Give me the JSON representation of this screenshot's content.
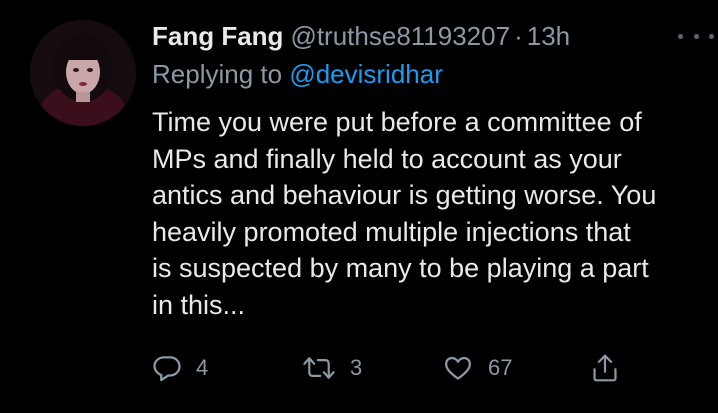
{
  "tweet": {
    "author": {
      "display_name": "Fang Fang",
      "handle": "@truthse81193207",
      "separator": "·",
      "time": "13h"
    },
    "reply_to": {
      "prefix": "Replying to",
      "mention": "@devisridhar"
    },
    "text_lines": [
      "Time you were put before a committee of",
      "MPs and finally held to account as your",
      "antics and behaviour is getting worse. You",
      "heavily promoted multiple injections that",
      "is suspected by many to be playing a part",
      "in this..."
    ],
    "actions": {
      "reply_count": "4",
      "retweet_count": "3",
      "like_count": "67"
    }
  },
  "icons": {
    "more": "more-horizontal-icon",
    "reply": "reply-bubble-icon",
    "retweet": "retweet-icon",
    "like": "heart-icon",
    "share": "share-icon"
  },
  "colors": {
    "background": "#000000",
    "text": "#e7e9ea",
    "secondary": "#8b98a5",
    "mention": "#1d9bf0"
  }
}
